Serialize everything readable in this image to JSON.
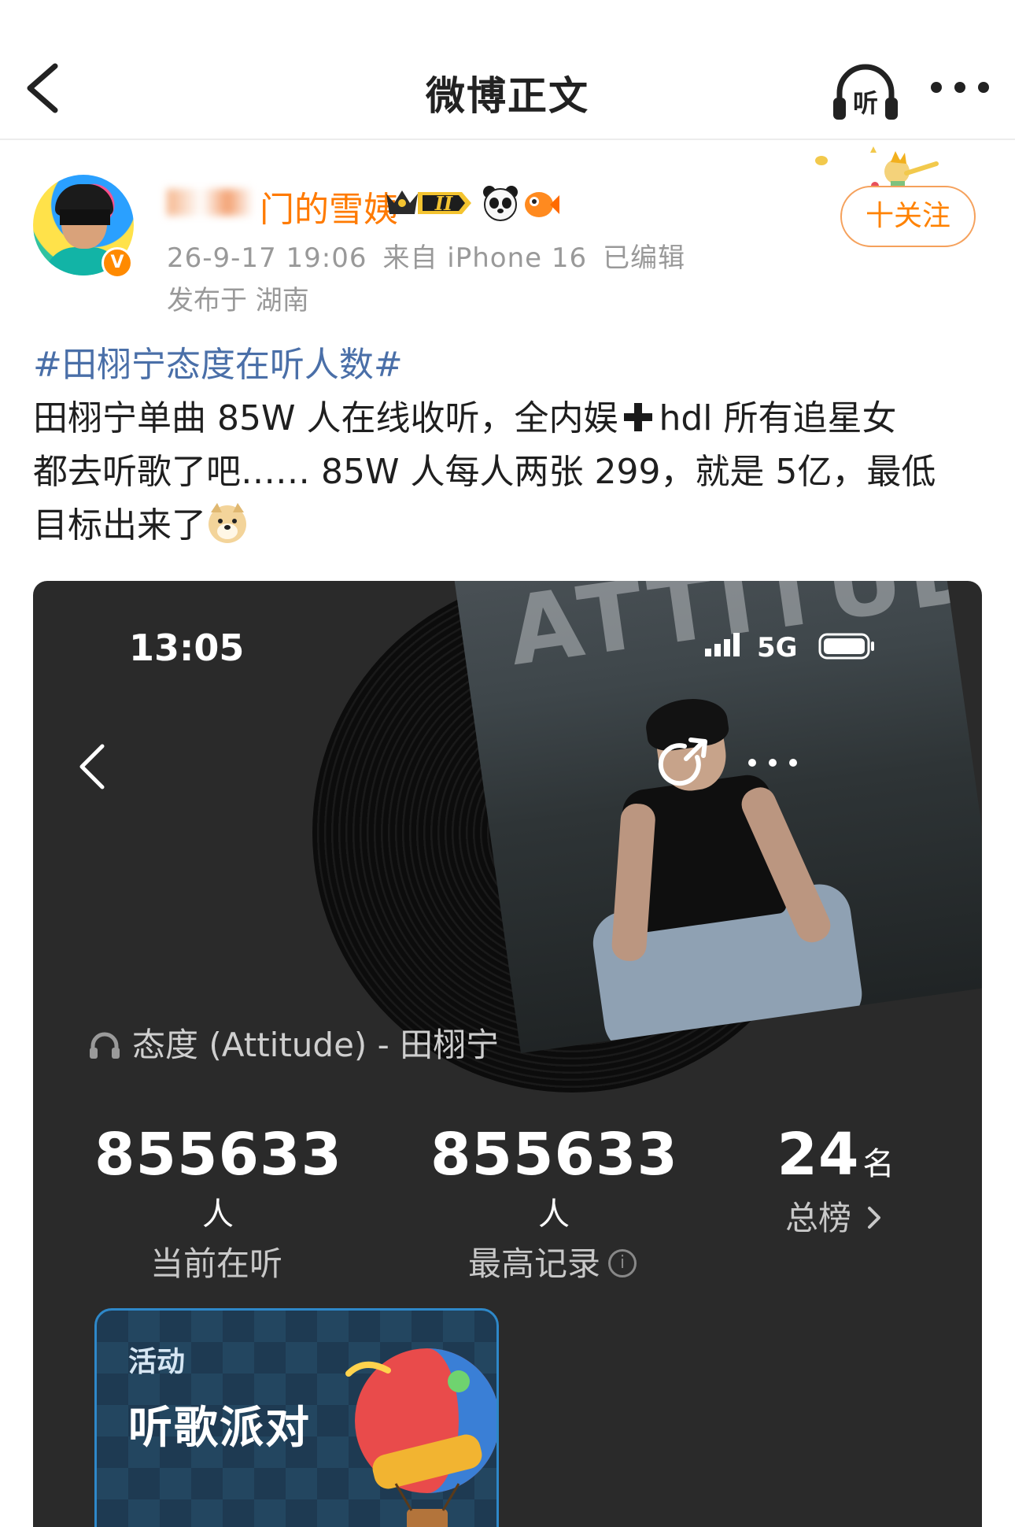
{
  "nav": {
    "title": "微博正文",
    "listen_label": "听"
  },
  "author": {
    "name": "门的雪姨",
    "badge_level": "II",
    "verified_mark": "V",
    "timestamp": "26-9-17 19:06",
    "source": "来自 iPhone 16",
    "edited": "已编辑",
    "location": "发布于 湖南",
    "follow_label": "十关注"
  },
  "post": {
    "hashtag": "#田栩宁态度在听人数#",
    "line1_a": "田栩宁单曲 85W 人在线收听，全内娱",
    "line1_b": "hdl 所有追星女",
    "line2": "都去听歌了吧…… 85W 人每人两张 299，就是 5亿，最低",
    "line3": "目标出来了"
  },
  "screenshot": {
    "time": "13:05",
    "network": "5G",
    "cover_text": "ATTITUDE",
    "song": "态度 (Attitude) - 田栩宁",
    "stats": [
      {
        "value": "855633",
        "unit": "人",
        "label": "当前在听"
      },
      {
        "value": "855633",
        "unit": "人",
        "label": "最高记录"
      },
      {
        "value": "24",
        "unit": "名",
        "label": "总榜"
      }
    ],
    "promo": {
      "tag": "活动",
      "title": "听歌派对"
    }
  },
  "colors": {
    "accent_orange": "#ff8200",
    "hashtag_blue": "#4a6fa8",
    "meta_gray": "#999999",
    "dark_bg": "#2a2a2a"
  }
}
